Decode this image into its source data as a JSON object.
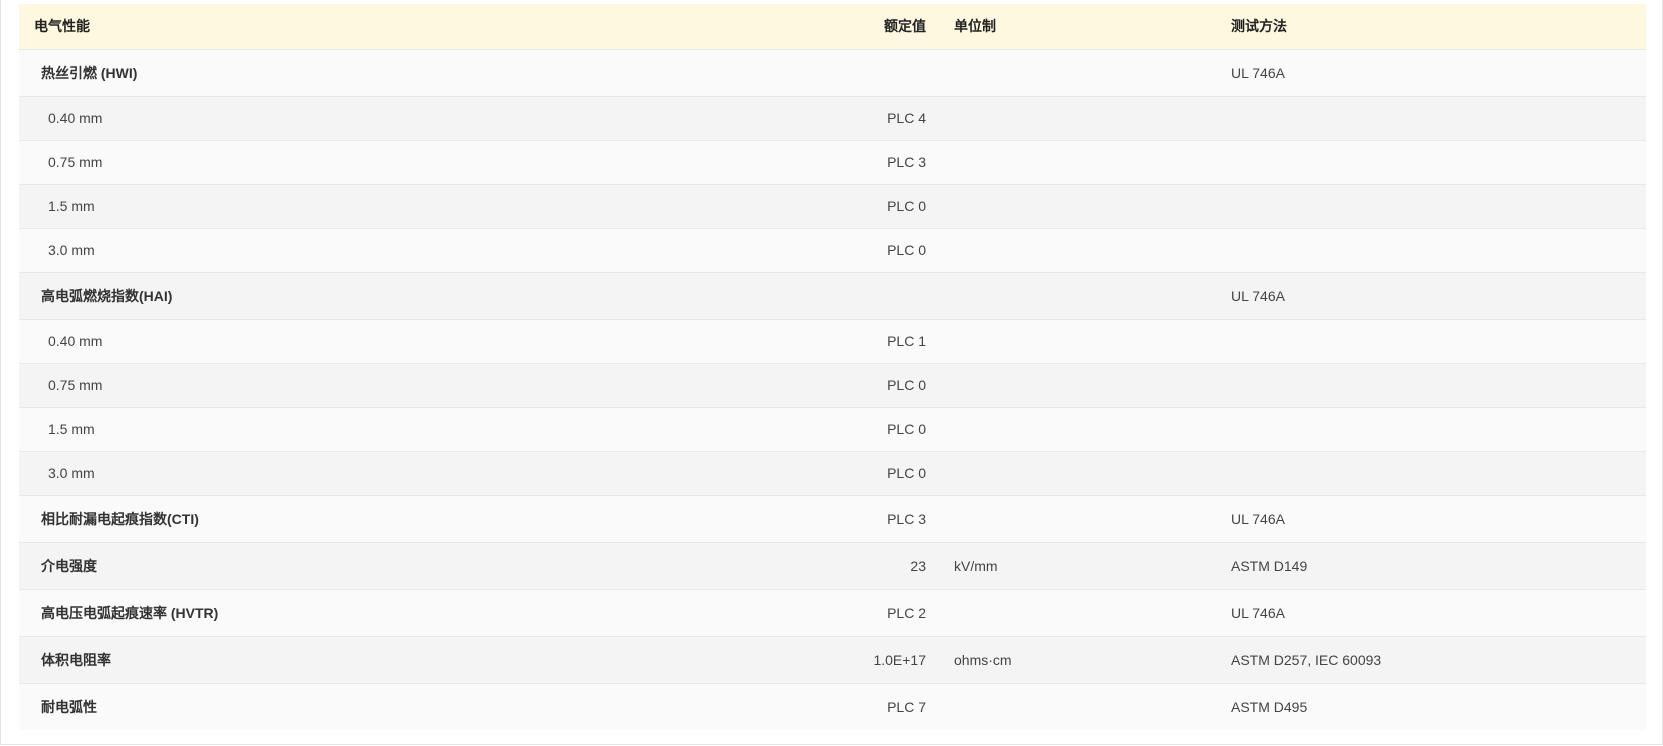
{
  "table": {
    "headers": {
      "property": "电气性能",
      "value": "额定值",
      "unit": "单位制",
      "method": "测试方法"
    },
    "rows": [
      {
        "property": "热丝引燃 (HWI)",
        "value": "",
        "unit": "",
        "method": "UL 746A",
        "kind": "group"
      },
      {
        "property": "0.40 mm",
        "value": "PLC 4",
        "unit": "",
        "method": "",
        "kind": "sub"
      },
      {
        "property": "0.75 mm",
        "value": "PLC 3",
        "unit": "",
        "method": "",
        "kind": "sub"
      },
      {
        "property": "1.5 mm",
        "value": "PLC 0",
        "unit": "",
        "method": "",
        "kind": "sub"
      },
      {
        "property": "3.0 mm",
        "value": "PLC 0",
        "unit": "",
        "method": "",
        "kind": "sub"
      },
      {
        "property": "高电弧燃烧指数(HAI)",
        "value": "",
        "unit": "",
        "method": "UL 746A",
        "kind": "group"
      },
      {
        "property": "0.40 mm",
        "value": "PLC 1",
        "unit": "",
        "method": "",
        "kind": "sub"
      },
      {
        "property": "0.75 mm",
        "value": "PLC 0",
        "unit": "",
        "method": "",
        "kind": "sub"
      },
      {
        "property": "1.5 mm",
        "value": "PLC 0",
        "unit": "",
        "method": "",
        "kind": "sub"
      },
      {
        "property": "3.0 mm",
        "value": "PLC 0",
        "unit": "",
        "method": "",
        "kind": "sub"
      },
      {
        "property": "相比耐漏电起痕指数(CTI)",
        "value": "PLC 3",
        "unit": "",
        "method": "UL 746A",
        "kind": "group"
      },
      {
        "property": "介电强度",
        "value": "23",
        "unit": "kV/mm",
        "method": "ASTM D149",
        "kind": "group"
      },
      {
        "property": "高电压电弧起痕速率 (HVTR)",
        "value": "PLC 2",
        "unit": "",
        "method": "UL 746A",
        "kind": "group"
      },
      {
        "property": "体积电阻率",
        "value": "1.0E+17",
        "unit": "ohms·cm",
        "method": "ASTM D257, IEC 60093",
        "kind": "group"
      },
      {
        "property": "耐电弧性",
        "value": "PLC 7",
        "unit": "",
        "method": "ASTM D495",
        "kind": "group"
      }
    ]
  }
}
